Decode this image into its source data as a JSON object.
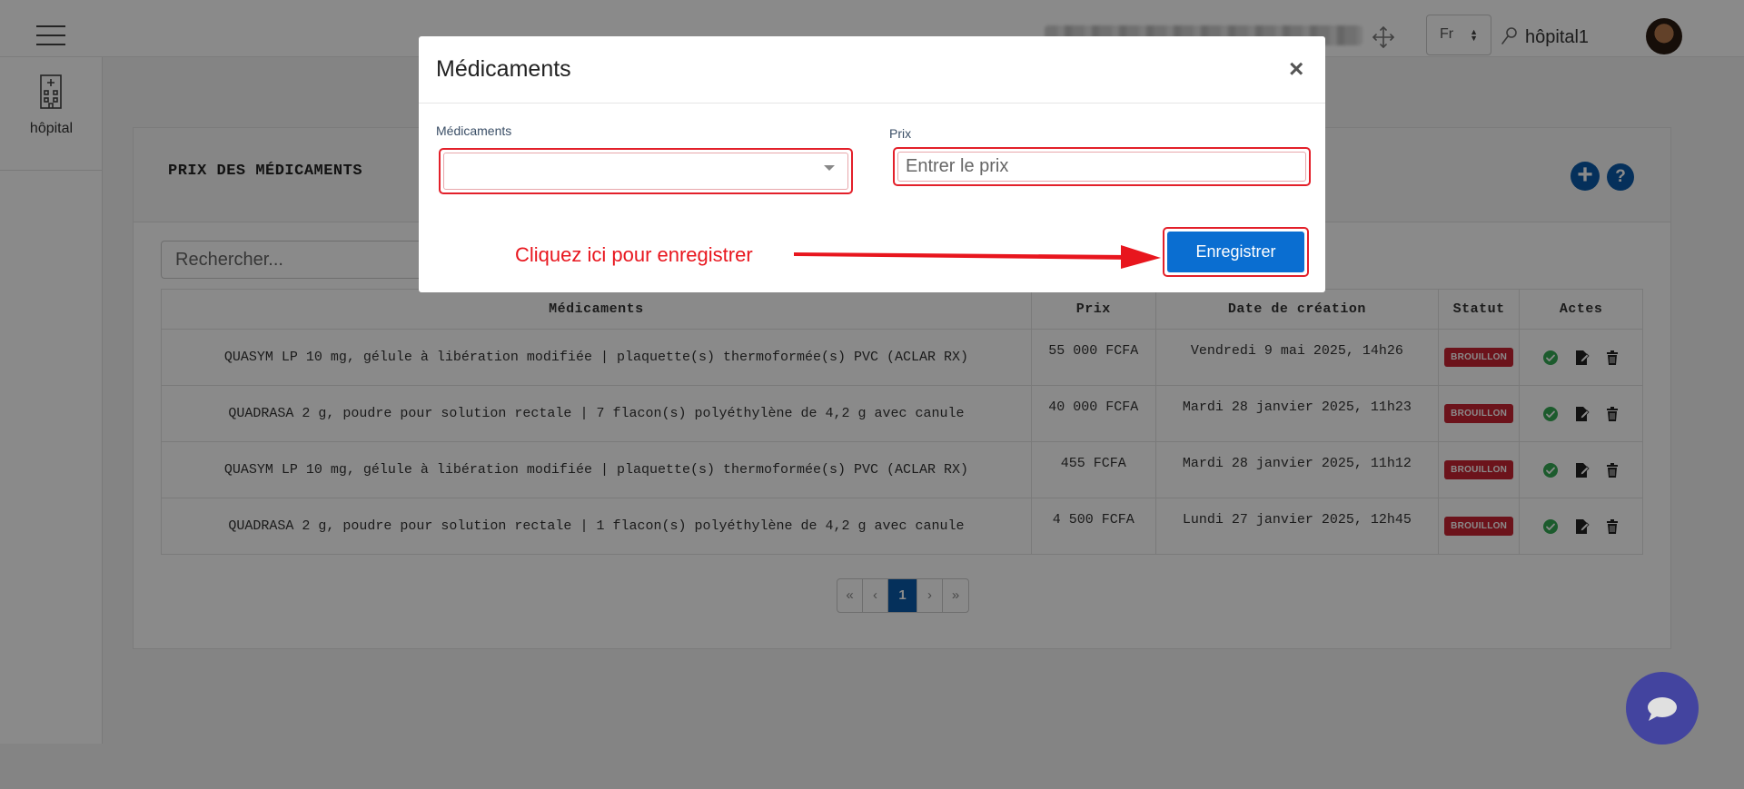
{
  "header": {
    "language": "Fr",
    "username": "hôpital1"
  },
  "sidebar": {
    "items": [
      {
        "label": "hôpital"
      }
    ]
  },
  "panel": {
    "title": "PRIX DES MÉDICAMENTS",
    "add_label": "+",
    "help_label": "?",
    "search_placeholder": "Rechercher..."
  },
  "table": {
    "columns": [
      "Médicaments",
      "Prix",
      "Date de création",
      "Statut",
      "Actes"
    ],
    "rows": [
      {
        "medicament": "QUASYM LP 10 mg, gélule à libération modifiée | plaquette(s) thermoformée(s) PVC (ACLAR RX)",
        "prix": "55 000 FCFA",
        "date": "Vendredi 9 mai 2025, 14h26",
        "statut": "BROUILLON"
      },
      {
        "medicament": "QUADRASA 2 g, poudre pour solution rectale | 7 flacon(s) polyéthylène de 4,2 g avec canule",
        "prix": "40 000 FCFA",
        "date": "Mardi 28 janvier 2025, 11h23",
        "statut": "BROUILLON"
      },
      {
        "medicament": "QUASYM LP 10 mg, gélule à libération modifiée | plaquette(s) thermoformée(s) PVC (ACLAR RX)",
        "prix": "455 FCFA",
        "date": "Mardi 28 janvier 2025, 11h12",
        "statut": "BROUILLON"
      },
      {
        "medicament": "QUADRASA 2 g, poudre pour solution rectale | 1 flacon(s) polyéthylène de 4,2 g avec canule",
        "prix": "4 500 FCFA",
        "date": "Lundi 27 janvier 2025, 12h45",
        "statut": "BROUILLON"
      }
    ]
  },
  "pagination": {
    "first": "«",
    "prev": "‹",
    "current": "1",
    "next": "›",
    "last": "»"
  },
  "modal": {
    "title": "Médicaments",
    "close_label": "×",
    "medicaments_label": "Médicaments",
    "medicaments_value": "",
    "prix_label": "Prix",
    "prix_placeholder": "Entrer le prix",
    "save_label": "Enregistrer",
    "hint": "Cliquez ici pour enregistrer"
  },
  "colors": {
    "primary": "#0b5aa8",
    "button": "#0a6ed1",
    "highlight": "#e3202a",
    "badge": "#c82333",
    "chat": "#2e2fa8"
  },
  "icons": {
    "menu": "hamburger-icon",
    "move": "move-icon",
    "user": "user-icon",
    "hospital": "hospital-icon",
    "validate": "check-circle-icon",
    "edit": "edit-icon",
    "delete": "trash-icon",
    "chat": "chat-icon"
  }
}
